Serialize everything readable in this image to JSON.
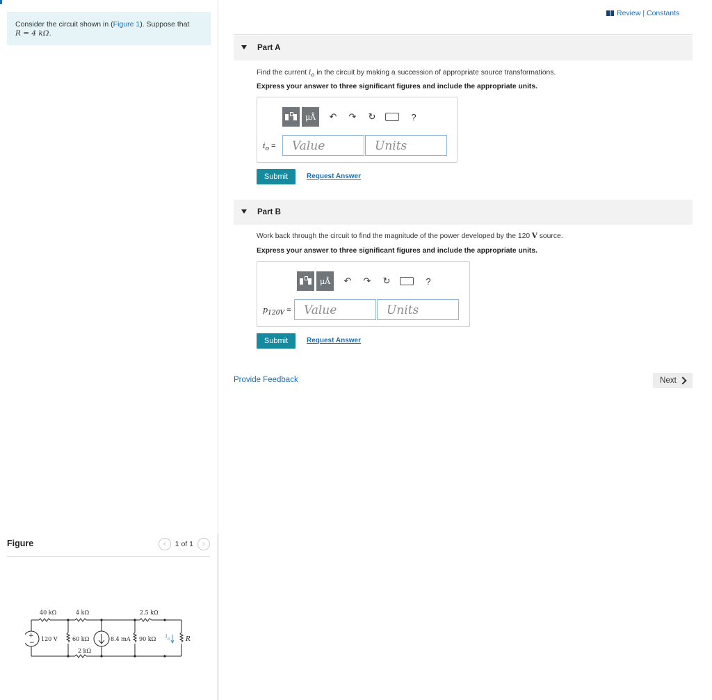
{
  "left_panel": {
    "prompt_text_1": "Consider the circuit shown in (",
    "prompt_link": "Figure 1",
    "prompt_text_2": "). Suppose that",
    "prompt_line2": "R = 4 kΩ.",
    "figure_title": "Figure",
    "figure_count": "1 of 1",
    "figure_labels": {
      "r40": "40 kΩ",
      "r4": "4 kΩ",
      "r25": "2.5 kΩ",
      "v120": "120 V",
      "r60": "60 kΩ",
      "i84": "8.4 mA",
      "r90": "90 kΩ",
      "io": "i",
      "io_sub": "o",
      "rR": "R",
      "r2": "2 kΩ",
      "plus": "+",
      "minus": "−"
    }
  },
  "header": {
    "review_label": "Review | Constants"
  },
  "parts": [
    {
      "title": "Part A",
      "question_pre": "Find the current ",
      "question_var": "i",
      "question_var_sub": "o",
      "question_post": " in the circuit by making a succession of appropriate source transformations.",
      "instruction": "Express your answer to three significant figures and include the appropriate units.",
      "var_label": "i",
      "var_label_sub": "o",
      "var_eq": " =",
      "value_placeholder": "Value",
      "units_placeholder": "Units",
      "submit_label": "Submit",
      "request_label": "Request Answer"
    },
    {
      "title": "Part B",
      "question_pre": "Work back through the circuit to find the magnitude of the power developed by the 120 ",
      "question_unit": "V",
      "question_post": " source.",
      "instruction": "Express your answer to three significant figures and include the appropriate units.",
      "var_label": "p",
      "var_label_sub": "120V",
      "var_eq": " =",
      "value_placeholder": "Value",
      "units_placeholder": "Units",
      "submit_label": "Submit",
      "request_label": "Request Answer"
    }
  ],
  "toolbar": {
    "template_icon": "templates-icon",
    "units_text": "μÅ",
    "undo_icon": "↶",
    "redo_icon": "↷",
    "reset_icon": "↻",
    "help_icon": "?"
  },
  "footer": {
    "feedback_label": "Provide Feedback",
    "next_label": "Next"
  }
}
